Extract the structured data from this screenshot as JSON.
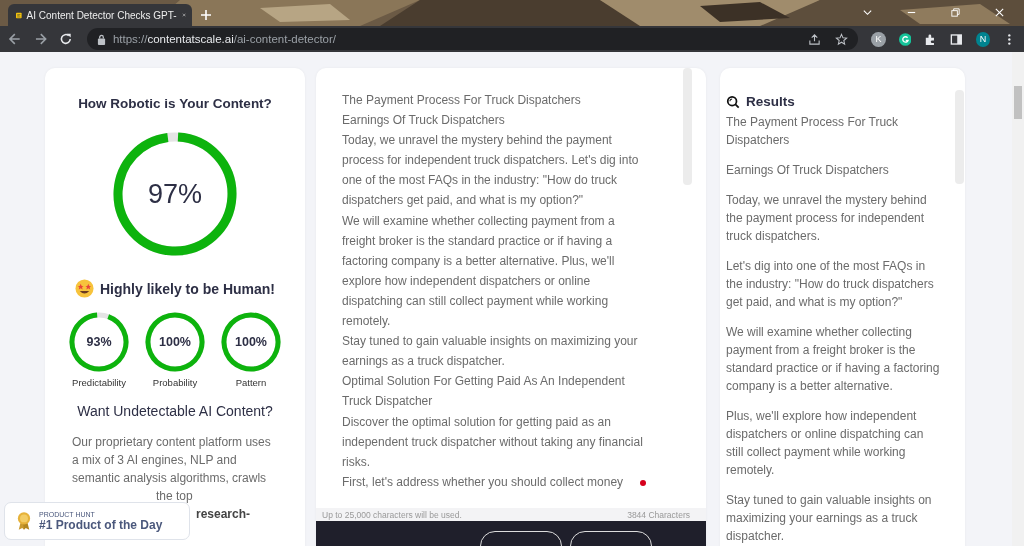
{
  "browser": {
    "tab_title": "AI Content Detector Checks GPT-",
    "url_scheme": "https://",
    "url_domain": "contentatscale.ai",
    "url_path": "/ai-content-detector/",
    "extension_initial": "K",
    "profile_initial": "N"
  },
  "score_card": {
    "title": "How Robotic is Your Content?",
    "score": {
      "text": "97%",
      "level": 0.97
    },
    "verdict": "Highly likely to be Human!",
    "metrics": [
      {
        "value": "93%",
        "level": 0.93,
        "label": "Predictability"
      },
      {
        "value": "100%",
        "level": 1,
        "label": "Probability"
      },
      {
        "value": "100%",
        "level": 1,
        "label": "Pattern"
      }
    ],
    "promo_title": "Want Undetectable AI Content?",
    "promo_lines": [
      "Our proprietary content platform uses",
      "a mix of 3 AI engines, NLP and",
      "semantic analysis algorithms, crawls"
    ],
    "promo_covered_lines": [
      {
        "text": "the top",
        "bold": false
      },
      {
        "text": "research-",
        "bold": true
      }
    ]
  },
  "editor": {
    "lines": [
      "The Payment Process For Truck Dispatchers",
      "Earnings Of Truck Dispatchers",
      "Today, we unravel the mystery behind the payment",
      "process for independent truck dispatchers. Let's dig into",
      "one of the most FAQs in the industry: \"How do truck",
      "dispatchers get paid, and what is my option?\"",
      "We will examine whether collecting payment from a",
      "freight broker is the standard practice or if having a",
      "factoring company is a better alternative. Plus, we'll",
      "explore how independent dispatchers or online",
      "dispatching can still collect payment while working",
      "remotely.",
      "Stay tuned to gain valuable insights on maximizing your",
      "earnings as a truck dispatcher.",
      "Optimal Solution For Getting Paid As An Independent",
      "Truck Dispatcher",
      "Discover the optimal solution for getting paid as an",
      "independent truck dispatcher without taking any financial",
      "risks.",
      "First, let's address whether you should collect money"
    ],
    "limit_note": "Up to 25,000 characters will be used.",
    "char_count": "3844 Characters"
  },
  "results": {
    "title": "Results",
    "paragraphs": [
      "The Payment Process For Truck Dispatchers",
      "Earnings Of Truck Dispatchers",
      "Today, we unravel the mystery behind the payment process for independent truck dispatchers.",
      "Let's dig into one of the most FAQs in the industry: \"How do truck dispatchers get paid, and what is my option?\"",
      "We will examine whether collecting payment from a freight broker is the standard practice or if having a factoring company is a better alternative.",
      "Plus, we'll explore how independent dispatchers or online dispatching can still collect payment while working remotely.",
      "Stay tuned to gain valuable insights on maximizing your earnings as a truck dispatcher."
    ]
  },
  "badge": {
    "overline": "PRODUCT HUNT",
    "title": "#1 Product of the Day"
  }
}
